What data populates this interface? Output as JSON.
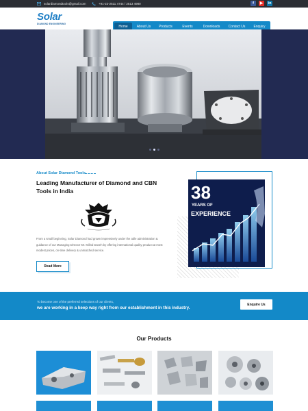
{
  "topbar": {
    "email": "solardiamondtools@gmail.com",
    "phone": "+91-22-2511 4744 / 2513 4980",
    "social": [
      {
        "name": "facebook",
        "glyph": "f",
        "color": "#3b5998"
      },
      {
        "name": "youtube",
        "glyph": "▶",
        "color": "#e52d27"
      },
      {
        "name": "linkedin",
        "glyph": "in",
        "color": "#0e76a8"
      }
    ]
  },
  "brand": {
    "name": "Solar",
    "tagline": "DIAMOND ENGINEERING",
    "color": "#1f7fc6"
  },
  "nav": {
    "items": [
      "Home",
      "About Us",
      "Products",
      "Events",
      "Downloads",
      "Contact Us",
      "Enquiry"
    ],
    "active": "Home",
    "accent": "#1389c8"
  },
  "about": {
    "eyebrow": "About Solar Diamond Tools",
    "title": "Leading Manufacturer of Diamond and CBN Tools in India",
    "text": "From a small beginning, Solar Diamond had grown impressively under the able administration & guidance of our Managing Director Mr. Milind Daveh by offering international quality product at most modest prices, on-time delivery & unmatched service.",
    "read_more": "Read More",
    "experience_number": "38",
    "experience_years": "YEARS OF",
    "experience_label": "EXPERIENCE"
  },
  "band": {
    "line1": "To become one of the preferred selections of our clients,",
    "line2": "we are working in a keep way right from our establishment in this industry.",
    "button": "Enquire Us"
  },
  "products": {
    "title": "Our Products"
  }
}
